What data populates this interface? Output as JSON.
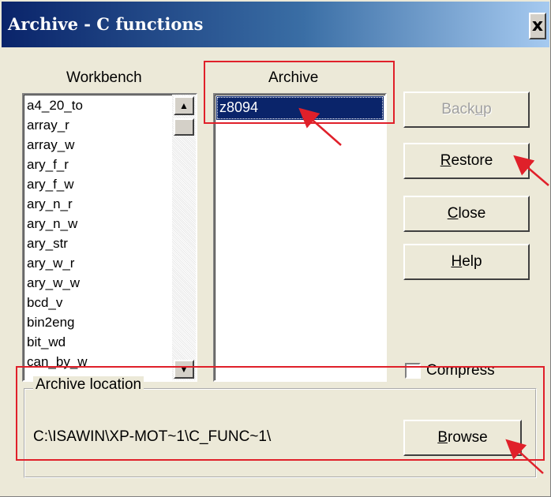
{
  "window": {
    "title": "Archive - C functions",
    "close_symbol": "x"
  },
  "workbench": {
    "label": "Workbench",
    "items": [
      "a4_20_to",
      "array_r",
      "array_w",
      "ary_f_r",
      "ary_f_w",
      "ary_n_r",
      "ary_n_w",
      "ary_str",
      "ary_w_r",
      "ary_w_w",
      "bcd_v",
      "bin2eng",
      "bit_wd",
      "can_by_w"
    ]
  },
  "archive": {
    "label": "Archive",
    "items": [
      "z8094"
    ],
    "selected": "z8094"
  },
  "buttons": {
    "backup": {
      "pre": "Back",
      "key": "u",
      "post": "p"
    },
    "restore": {
      "pre": "",
      "key": "R",
      "post": "estore"
    },
    "close": {
      "pre": "",
      "key": "C",
      "post": "lose"
    },
    "help": {
      "pre": "",
      "key": "H",
      "post": "elp"
    }
  },
  "compress": {
    "label": "Compress"
  },
  "location": {
    "group_label": "Archive location",
    "path": "C:\\ISAWIN\\XP-MOT~1\\C_FUNC~1\\",
    "browse": {
      "pre": "",
      "key": "B",
      "post": "rowse"
    }
  },
  "colors": {
    "title_start": "#0a246a",
    "title_end": "#a6caf0",
    "selection": "#0a246a",
    "annotation_red": "#e0202a",
    "dialog_bg": "#ece9d8"
  }
}
